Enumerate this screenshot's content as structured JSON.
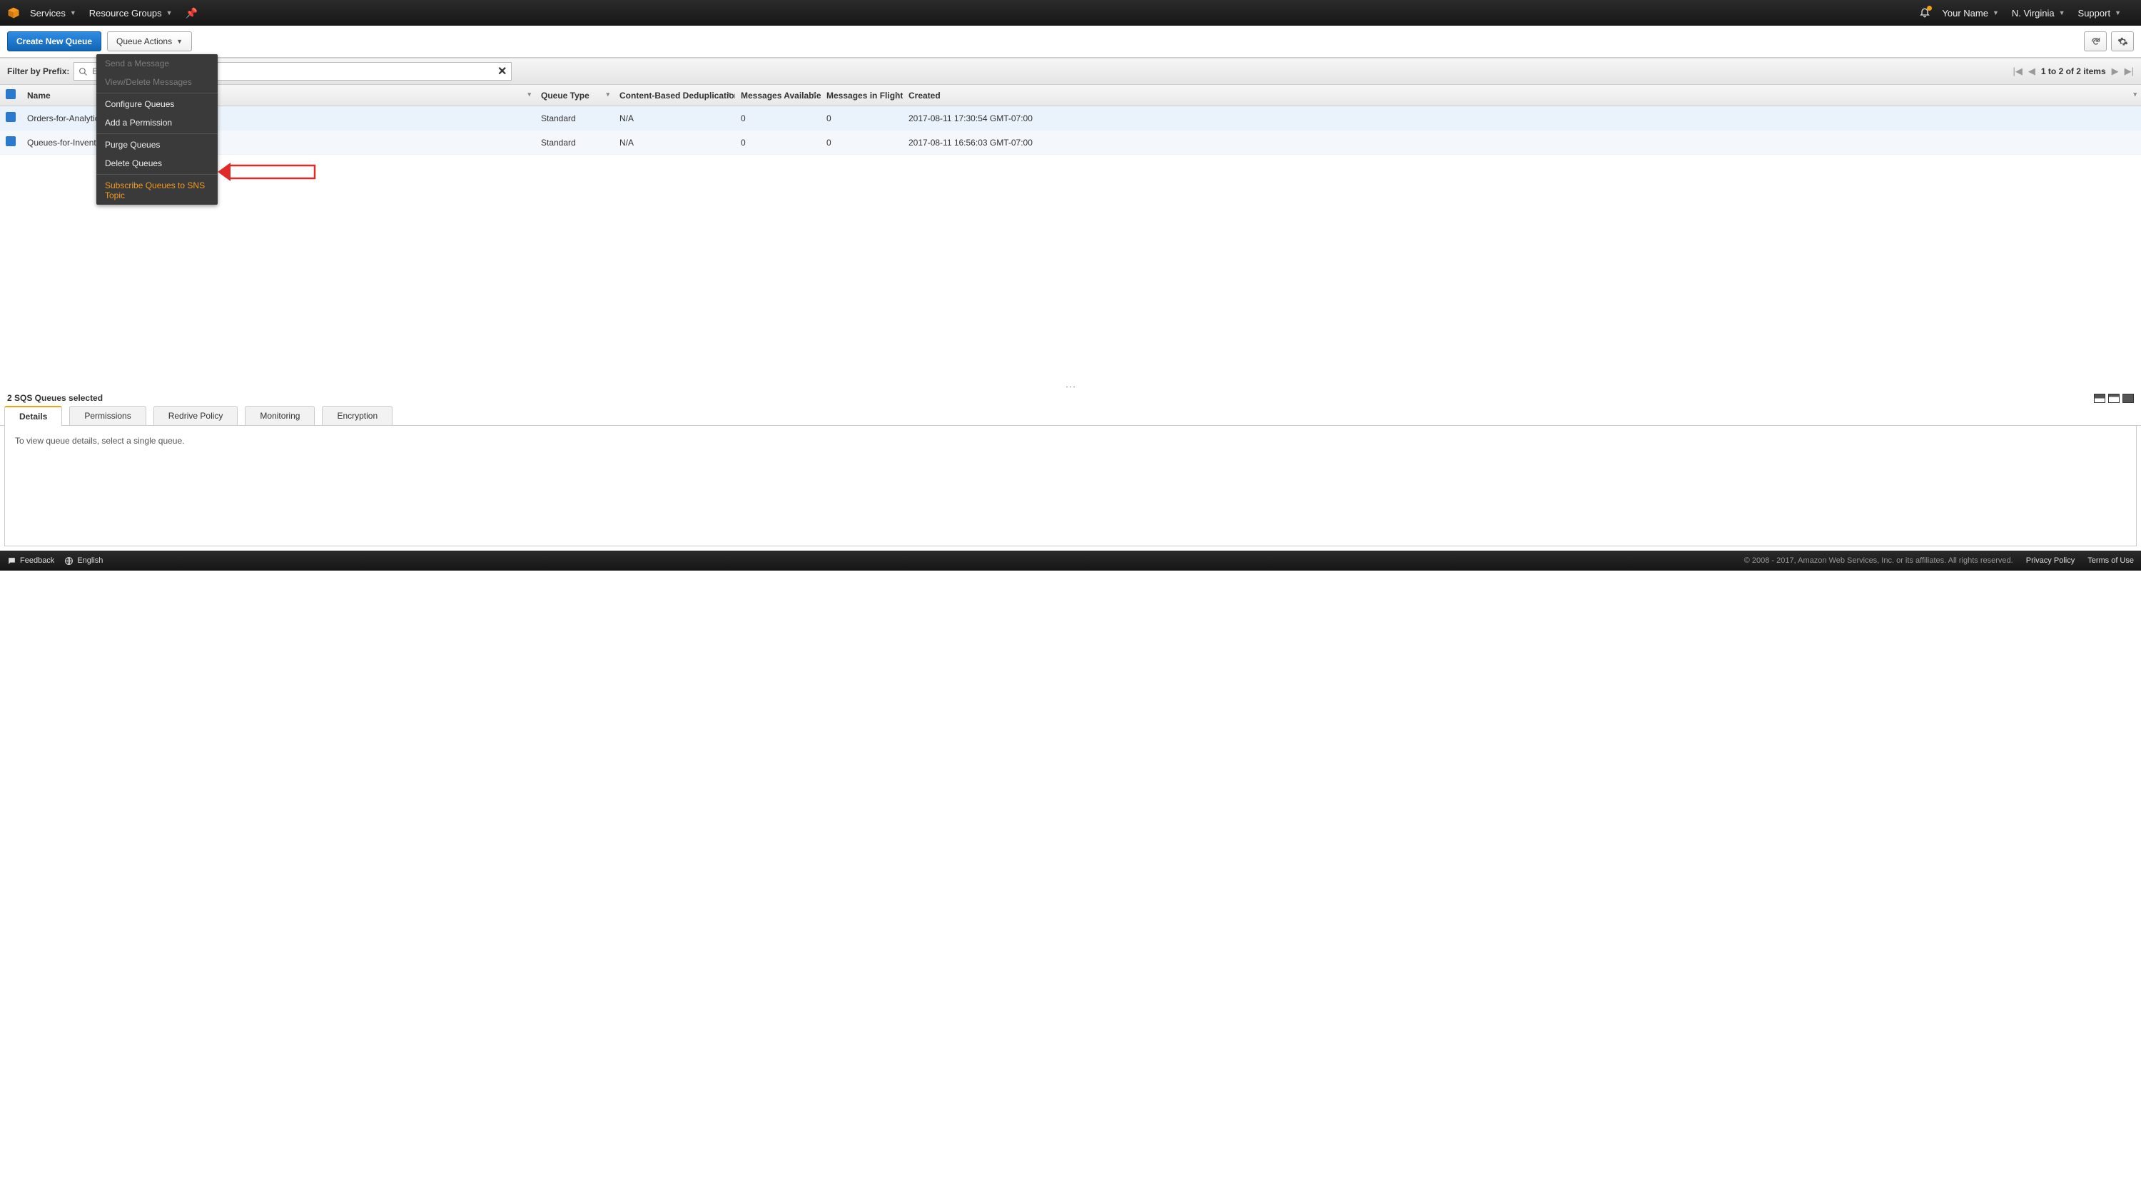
{
  "topnav": {
    "services": "Services",
    "resource_groups": "Resource Groups",
    "user": "Your Name",
    "region": "N. Virginia",
    "support": "Support"
  },
  "toolbar": {
    "create": "Create New Queue",
    "queue_actions": "Queue Actions"
  },
  "dropdown": {
    "send_message": "Send a Message",
    "view_delete": "View/Delete Messages",
    "configure": "Configure Queues",
    "add_permission": "Add a Permission",
    "purge": "Purge Queues",
    "delete": "Delete Queues",
    "subscribe": "Subscribe Queues to SNS Topic"
  },
  "filter": {
    "label": "Filter by Prefix:",
    "placeholder": "Ente"
  },
  "pager": {
    "text": "1 to 2 of 2 items"
  },
  "columns": {
    "name": "Name",
    "queue_type": "Queue Type",
    "dedup": "Content-Based Deduplication",
    "avail": "Messages Available",
    "inflight": "Messages in Flight",
    "created": "Created"
  },
  "rows": [
    {
      "name": "Orders-for-Analytics",
      "queue_type": "Standard",
      "dedup": "N/A",
      "avail": "0",
      "inflight": "0",
      "created": "2017-08-11 17:30:54 GMT-07:00"
    },
    {
      "name": "Queues-for-Inventory",
      "queue_type": "Standard",
      "dedup": "N/A",
      "avail": "0",
      "inflight": "0",
      "created": "2017-08-11 16:56:03 GMT-07:00"
    }
  ],
  "details": {
    "selected_text": "2 SQS Queues selected",
    "tabs": {
      "details": "Details",
      "permissions": "Permissions",
      "redrive": "Redrive Policy",
      "monitoring": "Monitoring",
      "encryption": "Encryption"
    },
    "body": "To view queue details, select a single queue."
  },
  "footer": {
    "feedback": "Feedback",
    "english": "English",
    "copyright": "© 2008 - 2017, Amazon Web Services, Inc. or its affiliates. All rights reserved.",
    "privacy": "Privacy Policy",
    "terms": "Terms of Use"
  }
}
